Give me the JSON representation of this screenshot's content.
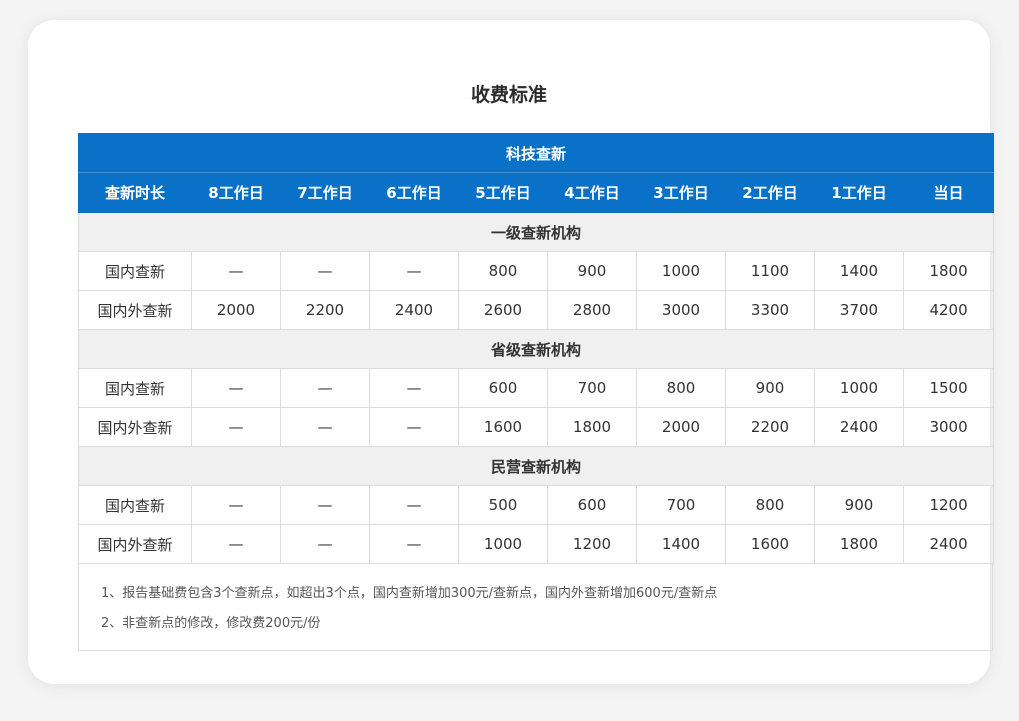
{
  "page": {
    "title": "收费标准"
  },
  "table": {
    "banner": "科技查新",
    "columns": [
      "查新时长",
      "8工作日",
      "7工作日",
      "6工作日",
      "5工作日",
      "4工作日",
      "3工作日",
      "2工作日",
      "1工作日",
      "当日"
    ],
    "groups": [
      {
        "name": "一级查新机构",
        "rows": [
          {
            "label": "国内查新",
            "values": [
              "—",
              "—",
              "—",
              "800",
              "900",
              "1000",
              "1100",
              "1400",
              "1800"
            ]
          },
          {
            "label": "国内外查新",
            "values": [
              "2000",
              "2200",
              "2400",
              "2600",
              "2800",
              "3000",
              "3300",
              "3700",
              "4200"
            ]
          }
        ]
      },
      {
        "name": "省级查新机构",
        "rows": [
          {
            "label": "国内查新",
            "values": [
              "—",
              "—",
              "—",
              "600",
              "700",
              "800",
              "900",
              "1000",
              "1500"
            ]
          },
          {
            "label": "国内外查新",
            "values": [
              "—",
              "—",
              "—",
              "1600",
              "1800",
              "2000",
              "2200",
              "2400",
              "3000"
            ]
          }
        ]
      },
      {
        "name": "民营查新机构",
        "rows": [
          {
            "label": "国内查新",
            "values": [
              "—",
              "—",
              "—",
              "500",
              "600",
              "700",
              "800",
              "900",
              "1200"
            ]
          },
          {
            "label": "国内外查新",
            "values": [
              "—",
              "—",
              "—",
              "1000",
              "1200",
              "1400",
              "1600",
              "1800",
              "2400"
            ]
          }
        ]
      }
    ]
  },
  "notes": [
    "1、报告基础费包含3个查新点，如超出3个点，国内查新增加300元/查新点，国内外查新增加600元/查新点",
    "2、非查新点的修改，修改费200元/份"
  ]
}
